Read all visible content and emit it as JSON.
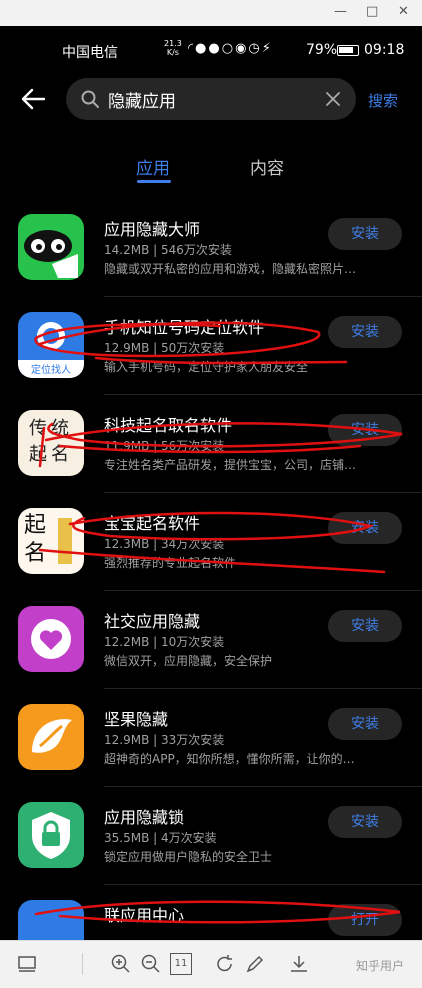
{
  "window_controls": {
    "minimize": "—",
    "maximize": "□",
    "close": "✕"
  },
  "status_bar": {
    "carrier": "中国电信",
    "network_speed_value": "21.3",
    "network_speed_unit": "K/s",
    "battery": "79%",
    "time": "09:18"
  },
  "search": {
    "query": "隐藏应用",
    "button_label": "搜索"
  },
  "tabs": [
    {
      "label": "应用",
      "active": true
    },
    {
      "label": "内容",
      "active": false
    }
  ],
  "apps": [
    {
      "name": "应用隐藏大师",
      "size": "14.2MB",
      "installs": "546万次安装",
      "description": "隐藏或双开私密的应用和游戏，隐藏私密照片…",
      "action": "安装"
    },
    {
      "name": "手机知位号码定位软件",
      "size": "12.9MB",
      "installs": "50万次安装",
      "description": "输入手机号码，定位守护家人朋友安全",
      "action": "安装",
      "icon_text": "定位找人"
    },
    {
      "name": "科技起名取名软件",
      "size": "11.9MB",
      "installs": "56万次安装",
      "description": "专注姓名类产品研发，提供宝宝，公司，店铺…",
      "action": "安装",
      "icon_text": "传统起名"
    },
    {
      "name": "宝宝起名软件",
      "size": "12.3MB",
      "installs": "34万次安装",
      "description": "强烈推荐的专业起名软件",
      "action": "安装",
      "icon_text": "起名"
    },
    {
      "name": "社交应用隐藏",
      "size": "12.2MB",
      "installs": "10万次安装",
      "description": "微信双开，应用隐藏，安全保护",
      "action": "安装"
    },
    {
      "name": "坚果隐藏",
      "size": "12.9MB",
      "installs": "33万次安装",
      "description": "超神奇的APP，知你所想，懂你所需，让你的…",
      "action": "安装"
    },
    {
      "name": "应用隐藏锁",
      "size": "35.5MB",
      "installs": "4万次安装",
      "description": "锁定应用做用户隐私的安全卫士",
      "action": "安装"
    },
    {
      "name": "联应用中心",
      "action": "打开"
    }
  ],
  "bottom_toolbar": {
    "page_counter": "11",
    "watermark": "知乎用户"
  },
  "colors": {
    "accent": "#3f7ee8",
    "background": "#000000",
    "annotation_red": "#e01010"
  }
}
